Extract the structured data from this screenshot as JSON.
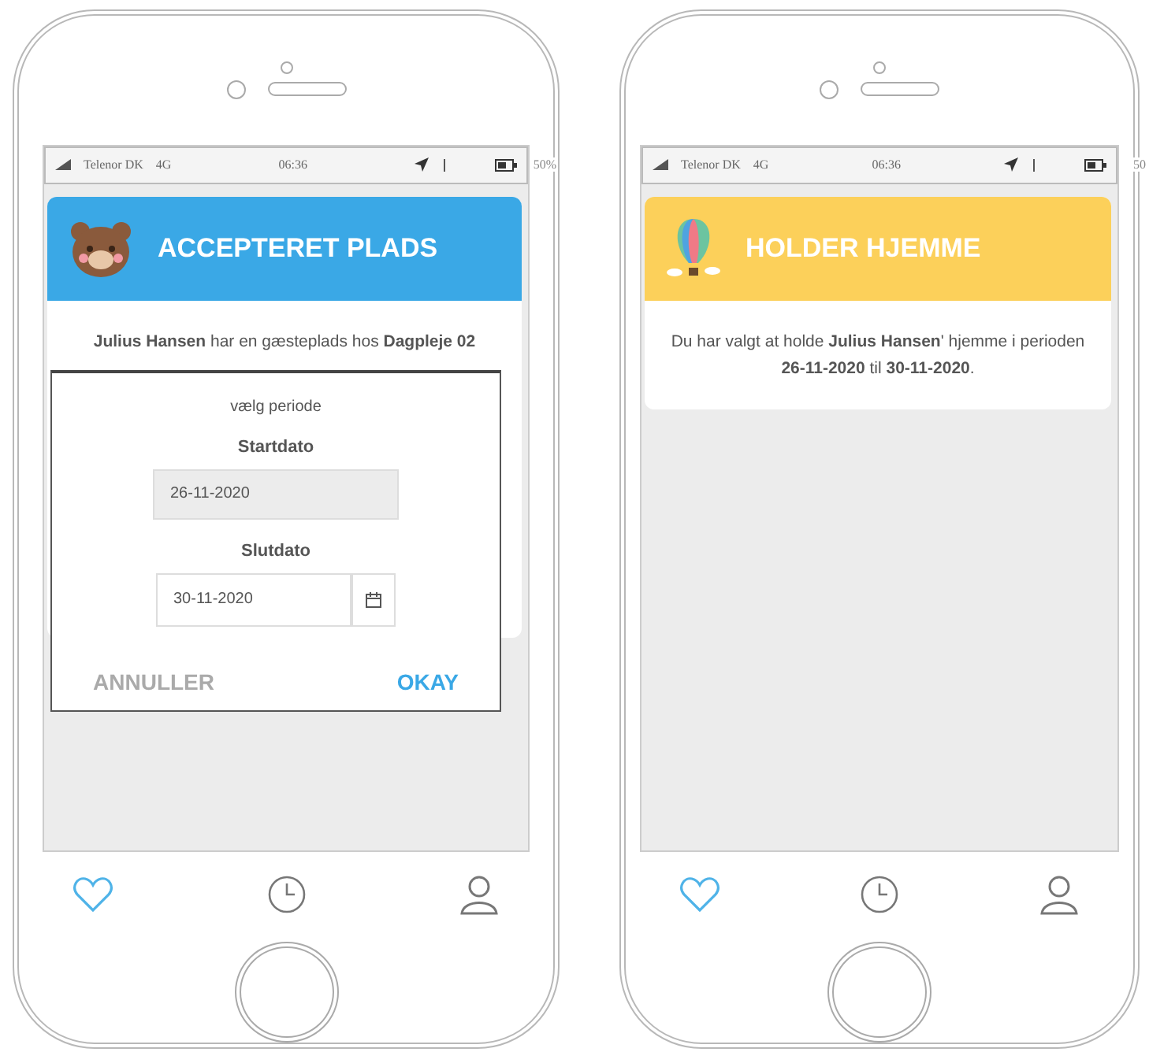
{
  "phones": [
    {
      "status_bar": {
        "carrier": "Telenor DK",
        "network": "4G",
        "time": "06:36",
        "battery": "50%"
      },
      "card": {
        "kind": "bear",
        "title": "ACCEPTERET PLADS",
        "color": "#3aa8e6",
        "message": "**Julius Hansen** har en gæsteplads hos **Dagpleje 02**"
      },
      "dialog": {
        "title": "vælg periode",
        "start_label": "Startdato",
        "start_value": "26-11-2020",
        "start_disabled": true,
        "end_label": "Slutdato",
        "end_value": "30-11-2020",
        "buttons": [
          {
            "label": "ANNULLER",
            "kind": "cancel"
          },
          {
            "label": "OKAY",
            "kind": "confirm"
          }
        ]
      },
      "nav": [
        {
          "kind": "heart",
          "selected": true
        },
        {
          "kind": "clock",
          "selected": false
        },
        {
          "kind": "person",
          "selected": false
        }
      ]
    },
    {
      "status_bar": {
        "carrier": "Telenor DK",
        "network": "4G",
        "time": "06:36",
        "battery": "50"
      },
      "card": {
        "kind": "balloon",
        "title": "HOLDER HJEMME",
        "color": "#fcd05a",
        "message": "Du har valgt at holde **Julius Hansen**' hjemme i perioden **26-11-2020** til **30-11-2020**."
      },
      "nav": [
        {
          "kind": "heart",
          "selected": true
        },
        {
          "kind": "clock",
          "selected": false
        },
        {
          "kind": "person",
          "selected": false
        }
      ]
    }
  ]
}
